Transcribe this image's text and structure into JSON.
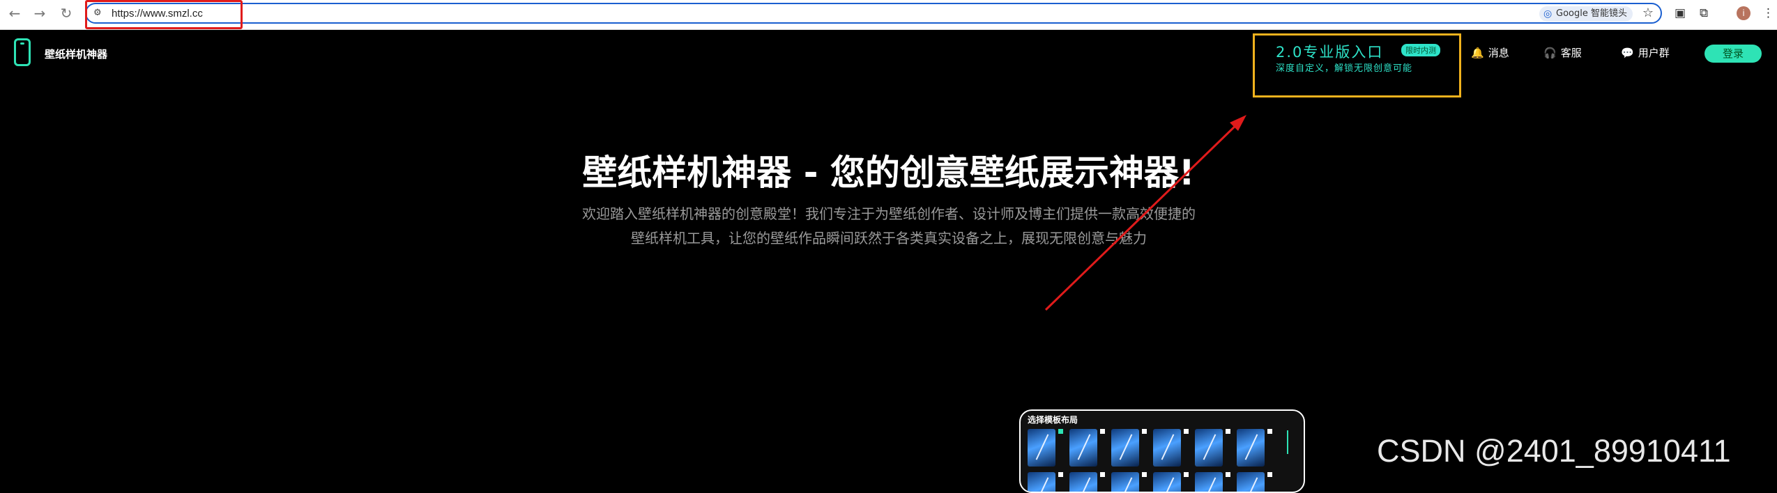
{
  "browser": {
    "url": "https://www.smzl.cc",
    "lens_label": "Google 智能镜头",
    "profile_initial": "i",
    "icons": [
      "back-icon",
      "forward-icon",
      "reload-icon",
      "site-settings-icon",
      "star-icon",
      "extension-icon",
      "puzzle-icon",
      "menu-icon"
    ]
  },
  "header": {
    "logo_text": "壁纸样机神器",
    "pro_title": "2.0专业版入口",
    "pro_badge": "限时内测",
    "pro_subtitle": "深度自定义，解锁无限创意可能",
    "nav": [
      {
        "label": "消息",
        "icon": "🔔"
      },
      {
        "label": "客服",
        "icon": "🎧"
      },
      {
        "label": "用户群",
        "icon": "💬"
      }
    ],
    "login_label": "登录"
  },
  "hero": {
    "title": "壁纸样机神器 - 您的创意壁纸展示神器!",
    "desc_line1": "欢迎踏入壁纸样机神器的创意殿堂！我们专注于为壁纸创作者、设计师及博主们提供一款高效便捷的",
    "desc_line2": "壁纸样机工具，让您的壁纸作品瞬间跃然于各类真实设备之上，展现无限创意与魅力"
  },
  "template_panel": {
    "title": "选择模板布局"
  },
  "watermark": "CSDN @2401_89910411",
  "colors": {
    "accent": "#2ee3b5",
    "highlight_box": "#f1b21d",
    "annotation_red": "#e01b1b"
  }
}
